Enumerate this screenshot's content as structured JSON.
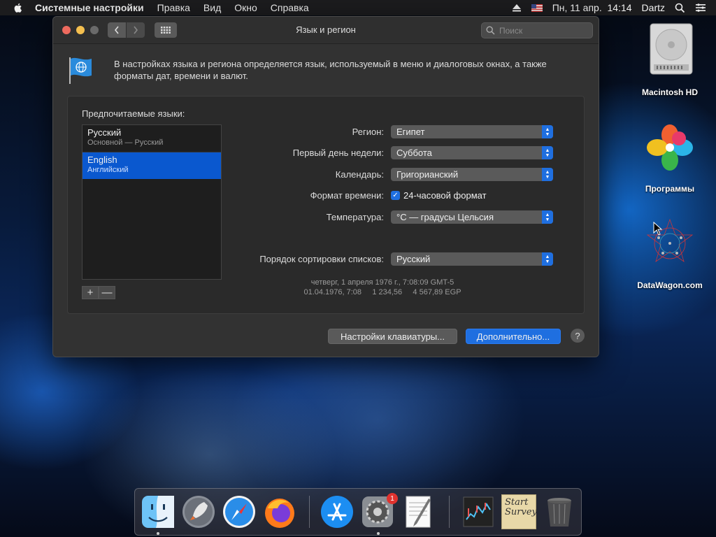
{
  "menubar": {
    "app_name": "Системные настройки",
    "items": [
      "Правка",
      "Вид",
      "Окно",
      "Справка"
    ],
    "datetime": "Пн, 11 апр.  14:14",
    "user": "Dartz"
  },
  "window": {
    "title": "Язык и регион",
    "search_placeholder": "Поиск",
    "intro": "В настройках языка и региона определяется язык, используемый в меню и диалоговых окнах, а также форматы дат, времени и валют.",
    "languages_title": "Предпочитаемые языки:",
    "languages": [
      {
        "name": "Русский",
        "sub": "Основной — Русский"
      },
      {
        "name": "English",
        "sub": "Английский"
      }
    ],
    "add_label": "+",
    "remove_label": "—",
    "labels": {
      "region": "Регион:",
      "first_day": "Первый день недели:",
      "calendar": "Календарь:",
      "time_format": "Формат времени:",
      "temperature": "Температура:",
      "sort_order": "Порядок сортировки списков:"
    },
    "values": {
      "region": "Египет",
      "first_day": "Суббота",
      "calendar": "Григорианский",
      "time_format": "24-часовой формат",
      "temperature": "°C — градусы Цельсия",
      "sort_order": "Русский"
    },
    "sample_line1": "четверг, 1 апреля 1976 г., 7:08:09 GMT-5",
    "sample_line2": "01.04.1976, 7:08     1 234,56     4 567,89 EGP",
    "keyboard_button": "Настройки клавиатуры...",
    "advanced_button": "Дополнительно...",
    "help_label": "?"
  },
  "desktop": {
    "icons": [
      "Macintosh HD",
      "Программы",
      "DataWagon.com"
    ]
  },
  "dock": {
    "badge_count": "1",
    "survey_note": "Start Survey"
  }
}
